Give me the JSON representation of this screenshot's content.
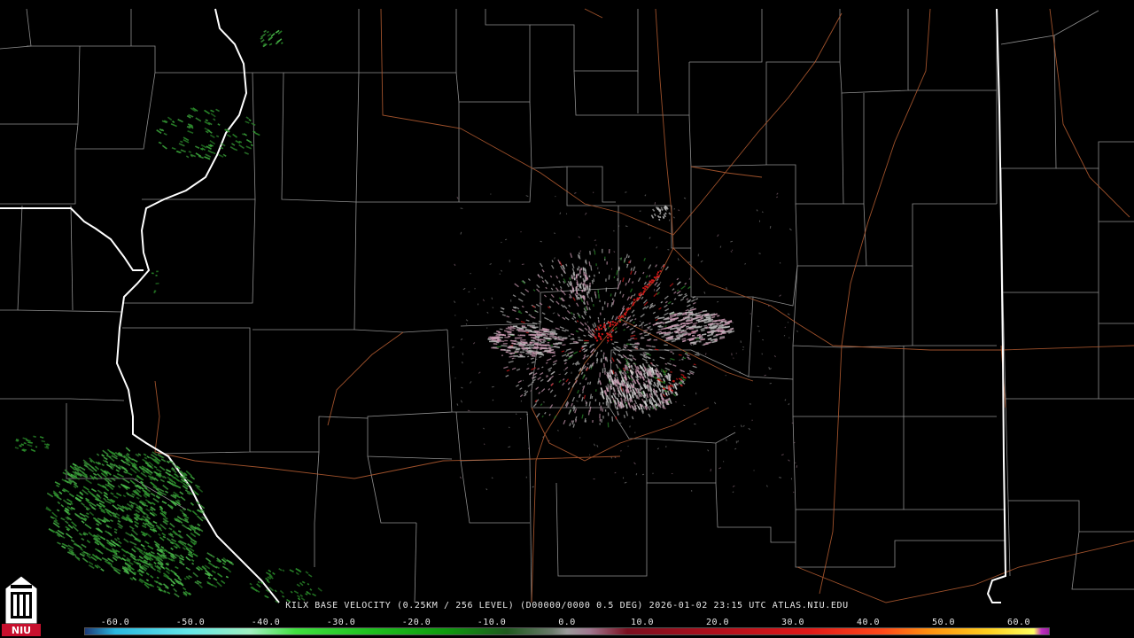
{
  "caption": "KILX BASE VELOCITY (0.25KM / 256 LEVEL) (D00000/0000 0.5 DEG) 2026-01-02 23:15 UTC  ATLAS.NIU.EDU",
  "logo": {
    "text": "NIU",
    "accent": "#c8102e"
  },
  "legend": {
    "ticks": [
      "-60.0",
      "-50.0",
      "-40.0",
      "-30.0",
      "-20.0",
      "-10.0",
      "0.0",
      "10.0",
      "20.0",
      "30.0",
      "40.0",
      "50.0",
      "60.0"
    ],
    "tick_values": [
      -60,
      -50,
      -40,
      -30,
      -20,
      -10,
      0,
      10,
      20,
      30,
      40,
      50,
      60
    ],
    "range": [
      -64,
      64
    ],
    "gradient": [
      {
        "v": -64,
        "c": "#1e3b78"
      },
      {
        "v": -60,
        "c": "#2ab8e0"
      },
      {
        "v": -50,
        "c": "#66e8e8"
      },
      {
        "v": -42,
        "c": "#a0f0c0"
      },
      {
        "v": -36,
        "c": "#3fe03f"
      },
      {
        "v": -26,
        "c": "#1fc01f"
      },
      {
        "v": -16,
        "c": "#0e9a0e"
      },
      {
        "v": -8,
        "c": "#1f5a1f"
      },
      {
        "v": -2,
        "c": "#6a7a6a"
      },
      {
        "v": 0,
        "c": "#9a9a9a"
      },
      {
        "v": 3,
        "c": "#a07890"
      },
      {
        "v": 8,
        "c": "#7a1020"
      },
      {
        "v": 20,
        "c": "#b0101c"
      },
      {
        "v": 32,
        "c": "#e01818"
      },
      {
        "v": 42,
        "c": "#ff4a1a"
      },
      {
        "v": 48,
        "c": "#ff9010"
      },
      {
        "v": 56,
        "c": "#ffd020"
      },
      {
        "v": 62,
        "c": "#ffff60"
      },
      {
        "v": 63,
        "c": "#c030c0"
      },
      {
        "v": 64,
        "c": "#a020a0"
      }
    ]
  },
  "map": {
    "background": "#000000",
    "county_line_color": "#a8a8a8",
    "state_line_color": "#ffffff",
    "highway_color": "#b05a30"
  },
  "radar": {
    "site": "KILX",
    "colors": {
      "inbound_green": "#2a8a2a",
      "inbound_light": "#4ab84a",
      "near_zero_gray": "#b8b8b8",
      "near_zero_pink": "#c898b0",
      "outbound_red": "#d01818"
    }
  }
}
